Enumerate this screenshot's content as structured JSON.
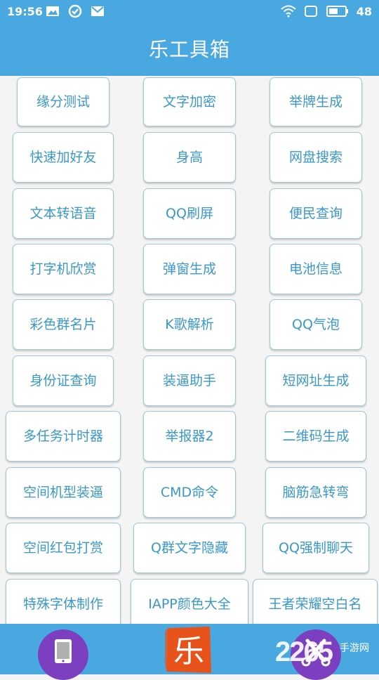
{
  "status_bar": {
    "time": "19:56",
    "battery": "48",
    "icons_left": [
      "image-icon",
      "check-circle-icon",
      "mail-icon"
    ],
    "icons_right": [
      "wifi-icon",
      "screen-icon",
      "battery-icon"
    ]
  },
  "app_bar": {
    "title": "乐工具箱"
  },
  "tools": [
    "缘分测试",
    "文字加密",
    "举牌生成",
    "快速加好友",
    "身高",
    "网盘搜索",
    "文本转语音",
    "QQ刷屏",
    "便民查询",
    "打字机欣赏",
    "弹窗生成",
    "电池信息",
    "彩色群名片",
    "K歌解析",
    "QQ气泡",
    "身份证查询",
    "装逼助手",
    "短网址生成",
    "多任务计时器",
    "举报器2",
    "二维码生成",
    "空间机型装逼",
    "CMD命令",
    "脑筋急转弯",
    "空间红包打赏",
    "Q群文字隐藏",
    "QQ强制聊天",
    "特殊字体制作",
    "IAPP颜色大全",
    "王者荣耀空白名"
  ],
  "bottom_nav": {
    "center_logo": "乐",
    "left_icon": "tablet-icon",
    "right_icon": "tools-icon"
  },
  "watermark": {
    "brand": "2265",
    "site": "手游网",
    "url": ""
  },
  "colors": {
    "primary": "#4aa8e0",
    "button_text": "#3a98c8",
    "nav_accent": "#7b3fc0",
    "logo_orange": "#e8531c"
  }
}
